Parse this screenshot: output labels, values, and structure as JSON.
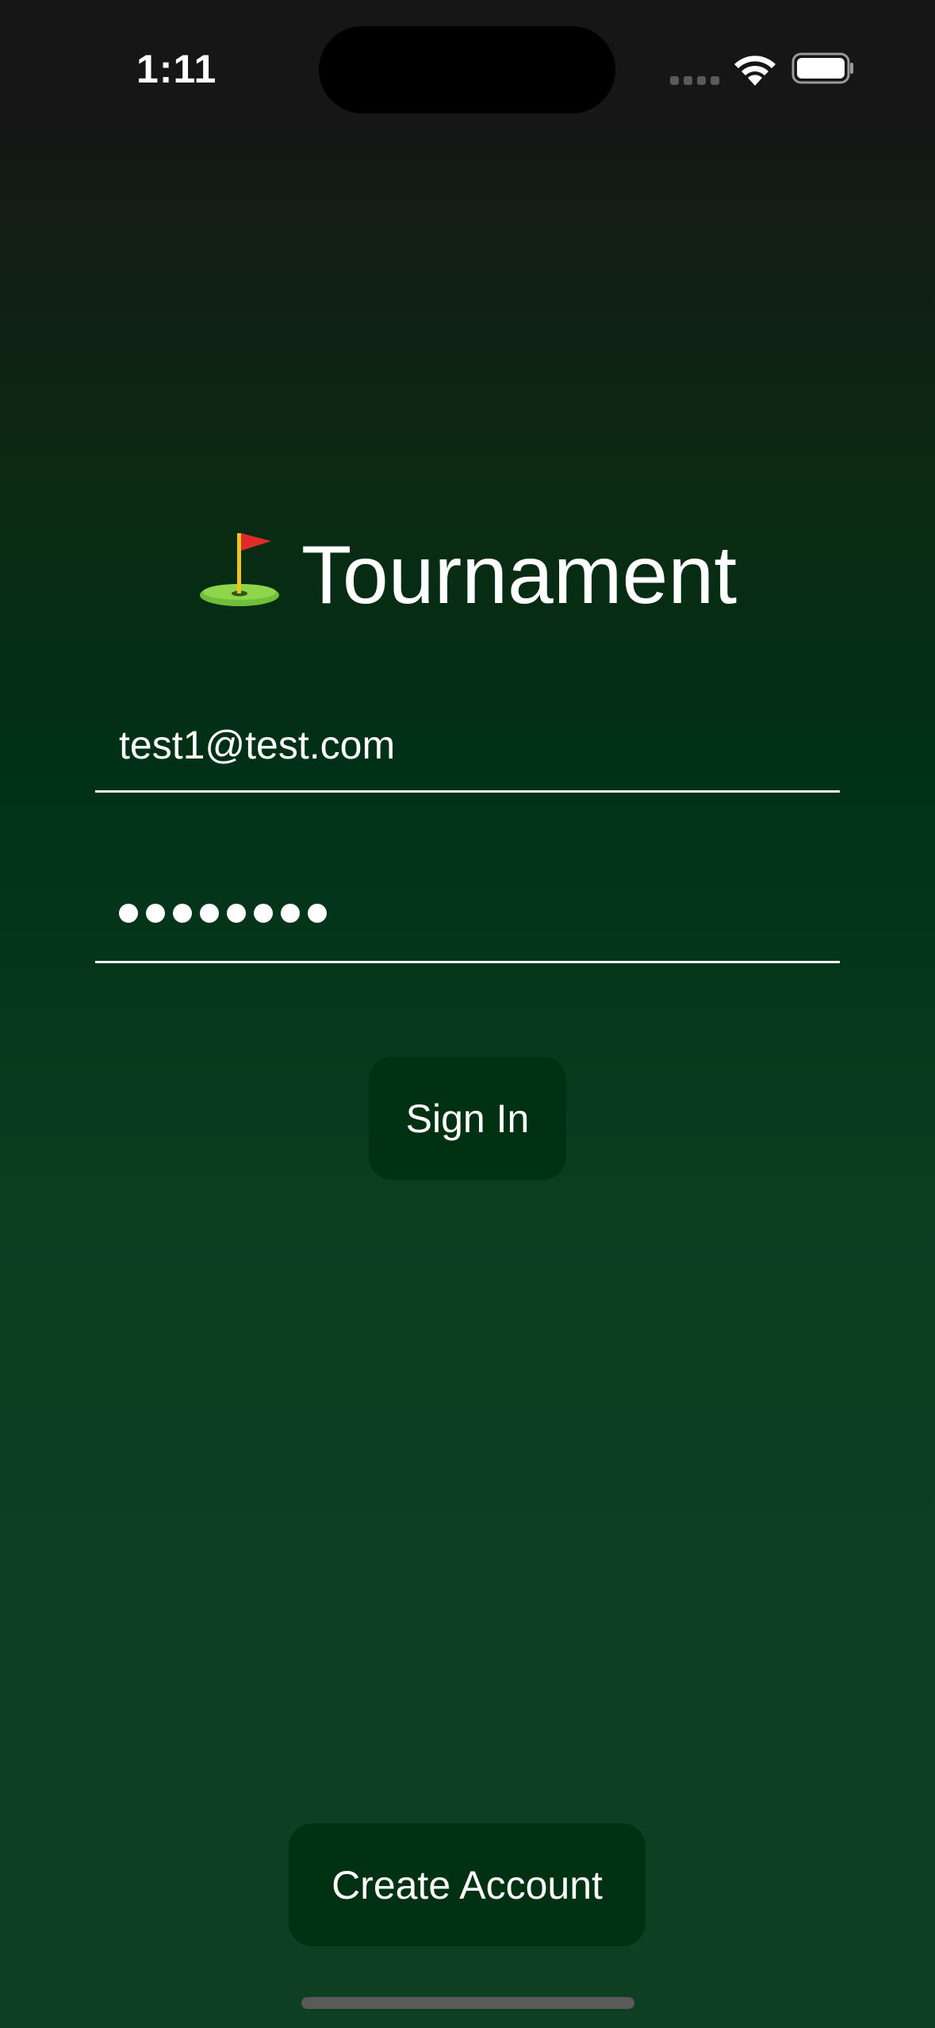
{
  "status_bar": {
    "time": "1:11"
  },
  "app": {
    "title": "Tournament",
    "title_icon": "flag-in-hole-icon"
  },
  "form": {
    "email_value": "test1@test.com",
    "password_mask_length": 8
  },
  "buttons": {
    "sign_in": "Sign In",
    "create_account": "Create Account"
  },
  "colors": {
    "button_bg": "#013113",
    "gradient_mid": "#003016",
    "text": "#ffffff"
  }
}
